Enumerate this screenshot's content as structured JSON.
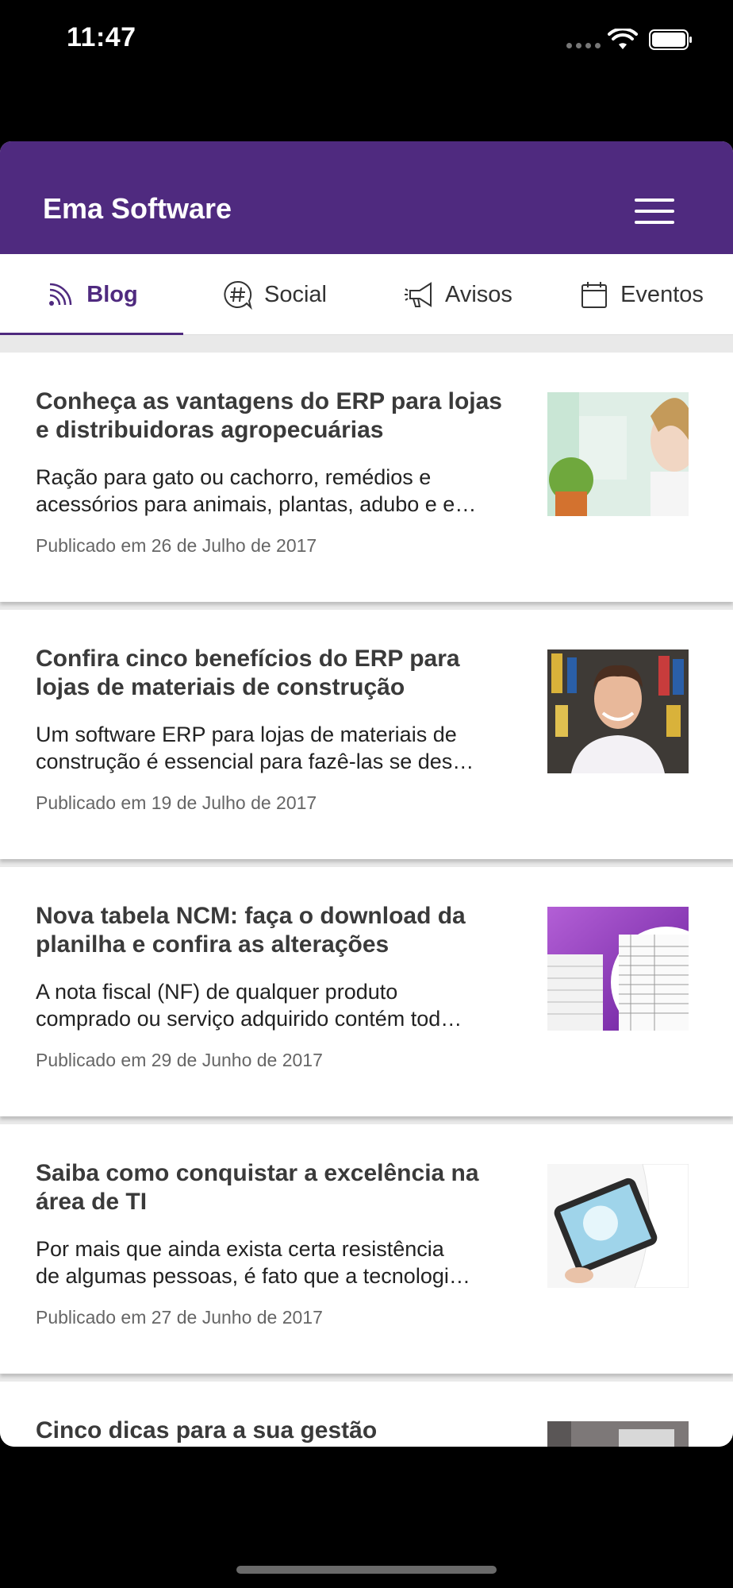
{
  "status": {
    "time": "11:47"
  },
  "app": {
    "title": "Ema Software"
  },
  "tabs": [
    {
      "label": "Blog",
      "icon": "rss-icon",
      "active": true
    },
    {
      "label": "Social",
      "icon": "hashtag-icon",
      "active": false
    },
    {
      "label": "Avisos",
      "icon": "megaphone-icon",
      "active": false
    },
    {
      "label": "Eventos",
      "icon": "calendar-icon",
      "active": false
    }
  ],
  "posts": [
    {
      "title": "Conheça as vantagens do ERP para lojas e distribuidoras agropecuárias",
      "excerpt_line1": "Ração para gato ou cachorro, remédios e",
      "excerpt_line2": "acessórios para animais, plantas, adubo e e…",
      "date": "Publicado em 26 de Julho de 2017"
    },
    {
      "title": "Confira cinco benefícios do ERP para lojas de materiais de construção",
      "excerpt_line1": "Um software ERP para lojas de materiais de",
      "excerpt_line2": "construção é essencial para fazê-las se des…",
      "date": "Publicado em 19 de Julho de 2017"
    },
    {
      "title": "Nova tabela NCM: faça o download da planilha e confira as alterações",
      "excerpt_line1": "A nota fiscal (NF) de qualquer produto",
      "excerpt_line2": "comprado ou serviço adquirido contém tod…",
      "date": "Publicado em 29 de Junho de 2017"
    },
    {
      "title": "Saiba como conquistar a excelência na área de TI",
      "excerpt_line1": "Por mais que ainda exista certa resistência",
      "excerpt_line2": "de algumas pessoas, é fato que a tecnologi…",
      "date": "Publicado em 27 de Junho de 2017"
    },
    {
      "title": "Cinco dicas para a sua gestão"
    }
  ],
  "colors": {
    "brand": "#4f2a7f",
    "background": "#e9e9e9"
  }
}
